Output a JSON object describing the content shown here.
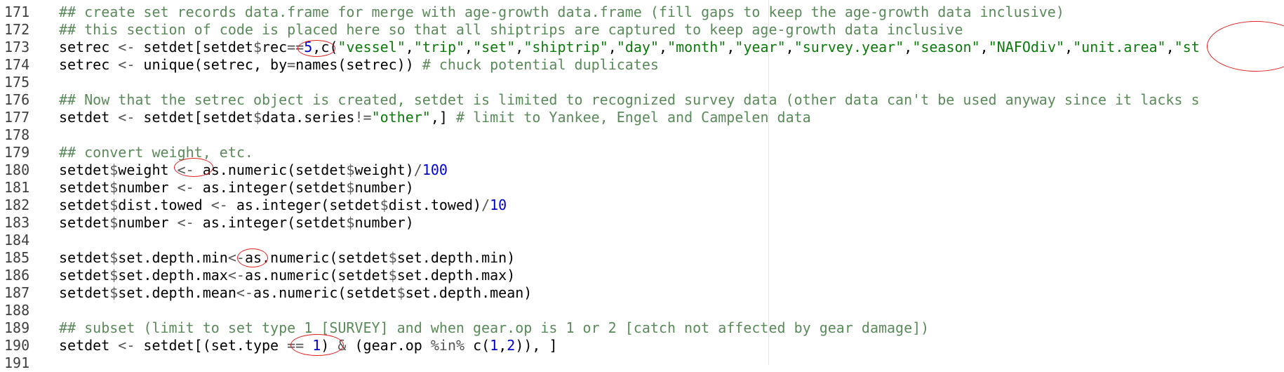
{
  "lines": [
    {
      "n": "171",
      "tokens": [
        {
          "t": "## create set records data.frame for merge with age-growth data.frame (fill gaps to keep the age-growth data inclusive)",
          "c": "cmt"
        }
      ]
    },
    {
      "n": "172",
      "tokens": [
        {
          "t": "## this section of code is placed here so that all shiptrips are captured to keep age-growth data inclusive",
          "c": "cmt"
        }
      ]
    },
    {
      "n": "173",
      "tokens": [
        {
          "t": "setrec ",
          "c": ""
        },
        {
          "t": "<- ",
          "c": "op"
        },
        {
          "t": "setdet[setdet",
          "c": ""
        },
        {
          "t": "$",
          "c": "op"
        },
        {
          "t": "rec",
          "c": ""
        },
        {
          "t": "==",
          "c": "op"
        },
        {
          "t": "5",
          "c": "num"
        },
        {
          "t": ",c(",
          "c": ""
        },
        {
          "t": "\"vessel\"",
          "c": "str"
        },
        {
          "t": ",",
          "c": ""
        },
        {
          "t": "\"trip\"",
          "c": "str"
        },
        {
          "t": ",",
          "c": ""
        },
        {
          "t": "\"set\"",
          "c": "str"
        },
        {
          "t": ",",
          "c": ""
        },
        {
          "t": "\"shiptrip\"",
          "c": "str"
        },
        {
          "t": ",",
          "c": ""
        },
        {
          "t": "\"day\"",
          "c": "str"
        },
        {
          "t": ",",
          "c": ""
        },
        {
          "t": "\"month\"",
          "c": "str"
        },
        {
          "t": ",",
          "c": ""
        },
        {
          "t": "\"year\"",
          "c": "str"
        },
        {
          "t": ",",
          "c": ""
        },
        {
          "t": "\"survey.year\"",
          "c": "str"
        },
        {
          "t": ",",
          "c": ""
        },
        {
          "t": "\"season\"",
          "c": "str"
        },
        {
          "t": ",",
          "c": ""
        },
        {
          "t": "\"NAFOdiv\"",
          "c": "str"
        },
        {
          "t": ",",
          "c": ""
        },
        {
          "t": "\"unit.area\"",
          "c": "str"
        },
        {
          "t": ",",
          "c": ""
        },
        {
          "t": "\"st",
          "c": "str"
        }
      ]
    },
    {
      "n": "174",
      "tokens": [
        {
          "t": "setrec ",
          "c": ""
        },
        {
          "t": "<- ",
          "c": "op"
        },
        {
          "t": "unique(setrec, by",
          "c": ""
        },
        {
          "t": "=",
          "c": "op"
        },
        {
          "t": "names(setrec)) ",
          "c": ""
        },
        {
          "t": "# chuck potential duplicates",
          "c": "cmt"
        }
      ]
    },
    {
      "n": "175",
      "tokens": []
    },
    {
      "n": "176",
      "tokens": [
        {
          "t": "## Now that the setrec object is created, setdet is limited to recognized survey data (other data can't be used anyway since it lacks s",
          "c": "cmt"
        }
      ]
    },
    {
      "n": "177",
      "tokens": [
        {
          "t": "setdet ",
          "c": ""
        },
        {
          "t": "<- ",
          "c": "op"
        },
        {
          "t": "setdet[setdet",
          "c": ""
        },
        {
          "t": "$",
          "c": "op"
        },
        {
          "t": "data.series",
          "c": ""
        },
        {
          "t": "!=",
          "c": "op"
        },
        {
          "t": "\"other\"",
          "c": "str"
        },
        {
          "t": ",] ",
          "c": ""
        },
        {
          "t": "# limit to Yankee, Engel and Campelen data",
          "c": "cmt"
        }
      ]
    },
    {
      "n": "178",
      "tokens": []
    },
    {
      "n": "179",
      "tokens": [
        {
          "t": "## convert weight, etc.",
          "c": "cmt"
        }
      ]
    },
    {
      "n": "180",
      "tokens": [
        {
          "t": "setdet",
          "c": ""
        },
        {
          "t": "$",
          "c": "op"
        },
        {
          "t": "weight ",
          "c": ""
        },
        {
          "t": "<- ",
          "c": "op"
        },
        {
          "t": "as.numeric(setdet",
          "c": ""
        },
        {
          "t": "$",
          "c": "op"
        },
        {
          "t": "weight)",
          "c": ""
        },
        {
          "t": "/",
          "c": "op"
        },
        {
          "t": "100",
          "c": "num"
        }
      ]
    },
    {
      "n": "181",
      "tokens": [
        {
          "t": "setdet",
          "c": ""
        },
        {
          "t": "$",
          "c": "op"
        },
        {
          "t": "number ",
          "c": ""
        },
        {
          "t": "<- ",
          "c": "op"
        },
        {
          "t": "as.integer(setdet",
          "c": ""
        },
        {
          "t": "$",
          "c": "op"
        },
        {
          "t": "number)",
          "c": ""
        }
      ]
    },
    {
      "n": "182",
      "tokens": [
        {
          "t": "setdet",
          "c": ""
        },
        {
          "t": "$",
          "c": "op"
        },
        {
          "t": "dist.towed ",
          "c": ""
        },
        {
          "t": "<- ",
          "c": "op"
        },
        {
          "t": "as.integer(setdet",
          "c": ""
        },
        {
          "t": "$",
          "c": "op"
        },
        {
          "t": "dist.towed)",
          "c": ""
        },
        {
          "t": "/",
          "c": "op"
        },
        {
          "t": "10",
          "c": "num"
        }
      ]
    },
    {
      "n": "183",
      "tokens": [
        {
          "t": "setdet",
          "c": ""
        },
        {
          "t": "$",
          "c": "op"
        },
        {
          "t": "number ",
          "c": ""
        },
        {
          "t": "<- ",
          "c": "op"
        },
        {
          "t": "as.integer(setdet",
          "c": ""
        },
        {
          "t": "$",
          "c": "op"
        },
        {
          "t": "number)",
          "c": ""
        }
      ]
    },
    {
      "n": "184",
      "tokens": []
    },
    {
      "n": "185",
      "tokens": [
        {
          "t": "setdet",
          "c": ""
        },
        {
          "t": "$",
          "c": "op"
        },
        {
          "t": "set.depth.min",
          "c": ""
        },
        {
          "t": "<-",
          "c": "op"
        },
        {
          "t": "as.numeric(setdet",
          "c": ""
        },
        {
          "t": "$",
          "c": "op"
        },
        {
          "t": "set.depth.min)",
          "c": ""
        }
      ]
    },
    {
      "n": "186",
      "tokens": [
        {
          "t": "setdet",
          "c": ""
        },
        {
          "t": "$",
          "c": "op"
        },
        {
          "t": "set.depth.max",
          "c": ""
        },
        {
          "t": "<-",
          "c": "op"
        },
        {
          "t": "as.numeric(setdet",
          "c": ""
        },
        {
          "t": "$",
          "c": "op"
        },
        {
          "t": "set.depth.max)",
          "c": ""
        }
      ]
    },
    {
      "n": "187",
      "tokens": [
        {
          "t": "setdet",
          "c": ""
        },
        {
          "t": "$",
          "c": "op"
        },
        {
          "t": "set.depth.mean",
          "c": ""
        },
        {
          "t": "<-",
          "c": "op"
        },
        {
          "t": "as.numeric(setdet",
          "c": ""
        },
        {
          "t": "$",
          "c": "op"
        },
        {
          "t": "set.depth.mean)",
          "c": ""
        }
      ]
    },
    {
      "n": "188",
      "tokens": []
    },
    {
      "n": "189",
      "tokens": [
        {
          "t": "## subset (limit to set type 1 [SURVEY] and when gear.op is 1 or 2 [catch not affected by gear damage])",
          "c": "cmt"
        }
      ]
    },
    {
      "n": "190",
      "tokens": [
        {
          "t": "setdet ",
          "c": ""
        },
        {
          "t": "<- ",
          "c": "op"
        },
        {
          "t": "setdet[(set.type ",
          "c": ""
        },
        {
          "t": "== ",
          "c": "op"
        },
        {
          "t": "1",
          "c": "num"
        },
        {
          "t": ") ",
          "c": ""
        },
        {
          "t": "& ",
          "c": "op"
        },
        {
          "t": "(gear.op ",
          "c": ""
        },
        {
          "t": "%in% ",
          "c": "op"
        },
        {
          "t": "c(",
          "c": ""
        },
        {
          "t": "1",
          "c": "num"
        },
        {
          "t": ",",
          "c": ""
        },
        {
          "t": "2",
          "c": "num"
        },
        {
          "t": ")), ]",
          "c": ""
        }
      ]
    },
    {
      "n": "191",
      "tokens": []
    }
  ]
}
